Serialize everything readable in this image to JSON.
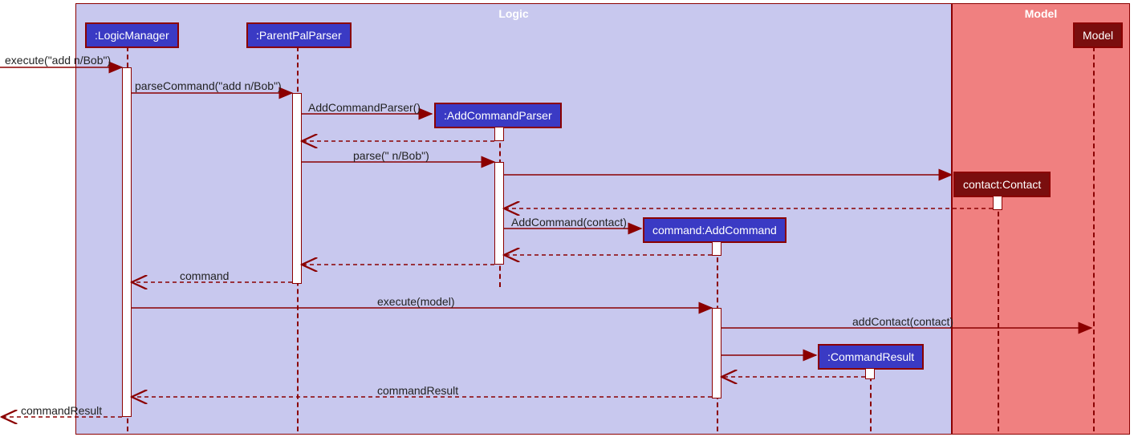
{
  "regions": {
    "logic": {
      "title": "Logic"
    },
    "model": {
      "title": "Model"
    }
  },
  "participants": {
    "logicManager": ":LogicManager",
    "parentPalParser": ":ParentPalParser",
    "addCommandParser": ":AddCommandParser",
    "contact": "contact:Contact",
    "addCommand": "command:AddCommand",
    "commandResult": ":CommandResult",
    "modelHead": "Model"
  },
  "messages": {
    "execute1": "execute(\"add n/Bob\")",
    "parseCommand": "parseCommand(\"add n/Bob\")",
    "ctorAddCommandParser": "AddCommandParser()",
    "parse": "parse(\" n/Bob\")",
    "ctorAddCommand": "AddCommand(contact)",
    "command": "command",
    "executeModel": "execute(model)",
    "addContact": "addContact(contact)",
    "commandResult": "commandResult",
    "commandResultOut": "commandResult"
  },
  "chart_data": {
    "type": "sequence-diagram",
    "regions": [
      {
        "name": "Logic",
        "participants": [
          "LogicManager",
          "ParentPalParser",
          "AddCommandParser",
          "AddCommand",
          "CommandResult"
        ]
      },
      {
        "name": "Model",
        "participants": [
          "Contact",
          "Model"
        ]
      }
    ],
    "participants": [
      {
        "id": "ext",
        "name": "(external caller)"
      },
      {
        "id": "LogicManager",
        "name": ":LogicManager"
      },
      {
        "id": "ParentPalParser",
        "name": ":ParentPalParser"
      },
      {
        "id": "AddCommandParser",
        "name": ":AddCommandParser",
        "created": true
      },
      {
        "id": "Contact",
        "name": "contact:Contact",
        "created": true
      },
      {
        "id": "AddCommand",
        "name": "command:AddCommand",
        "created": true
      },
      {
        "id": "CommandResult",
        "name": ":CommandResult",
        "created": true
      },
      {
        "id": "Model",
        "name": "Model"
      }
    ],
    "messages": [
      {
        "from": "ext",
        "to": "LogicManager",
        "label": "execute(\"add n/Bob\")",
        "kind": "sync"
      },
      {
        "from": "LogicManager",
        "to": "ParentPalParser",
        "label": "parseCommand(\"add n/Bob\")",
        "kind": "sync"
      },
      {
        "from": "ParentPalParser",
        "to": "AddCommandParser",
        "label": "AddCommandParser()",
        "kind": "create"
      },
      {
        "from": "AddCommandParser",
        "to": "ParentPalParser",
        "label": "",
        "kind": "return"
      },
      {
        "from": "ParentPalParser",
        "to": "AddCommandParser",
        "label": "parse(\" n/Bob\")",
        "kind": "sync"
      },
      {
        "from": "AddCommandParser",
        "to": "Contact",
        "label": "",
        "kind": "create"
      },
      {
        "from": "Contact",
        "to": "AddCommandParser",
        "label": "",
        "kind": "return"
      },
      {
        "from": "AddCommandParser",
        "to": "AddCommand",
        "label": "AddCommand(contact)",
        "kind": "create"
      },
      {
        "from": "AddCommand",
        "to": "AddCommandParser",
        "label": "",
        "kind": "return"
      },
      {
        "from": "AddCommandParser",
        "to": "ParentPalParser",
        "label": "",
        "kind": "return"
      },
      {
        "from": "ParentPalParser",
        "to": "LogicManager",
        "label": "command",
        "kind": "return"
      },
      {
        "from": "LogicManager",
        "to": "AddCommand",
        "label": "execute(model)",
        "kind": "sync"
      },
      {
        "from": "AddCommand",
        "to": "Model",
        "label": "addContact(contact)",
        "kind": "sync"
      },
      {
        "from": "AddCommand",
        "to": "CommandResult",
        "label": "",
        "kind": "create"
      },
      {
        "from": "CommandResult",
        "to": "AddCommand",
        "label": "",
        "kind": "return"
      },
      {
        "from": "AddCommand",
        "to": "LogicManager",
        "label": "commandResult",
        "kind": "return"
      },
      {
        "from": "LogicManager",
        "to": "ext",
        "label": "commandResult",
        "kind": "return"
      }
    ]
  }
}
